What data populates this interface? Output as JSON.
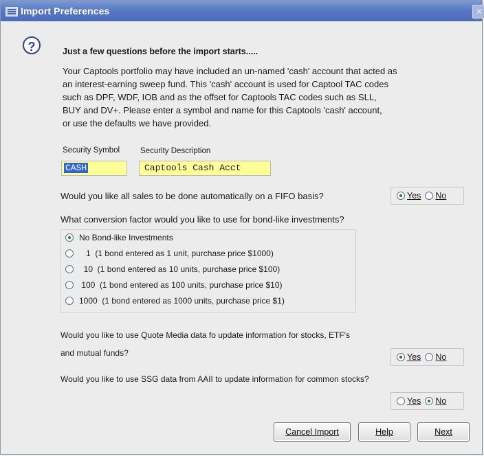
{
  "window": {
    "title": "Import Preferences"
  },
  "header": {
    "heading": "Just a few questions before the import starts....."
  },
  "intro": {
    "lines": [
      "Your Captools portfolio may have included an un-named 'cash' account that acted as",
      "an interest-earning sweep fund. This 'cash' account is used for Captool TAC codes",
      "such as DPF, WDF, IOB and as the offset for Captools TAC codes such as SLL,",
      "BUY and DV+. Please enter a symbol and name for this Captools 'cash' account,",
      "or use the defaults we have provided."
    ]
  },
  "cash": {
    "symbol_label": "Security Symbol",
    "description_label": "Security Description",
    "symbol_value": "CASH",
    "description_value": "Captools Cash Acct"
  },
  "fifo": {
    "question": "Would you like all sales to be done automatically on a FIFO basis?",
    "yes_label": "Yes",
    "no_label": "No",
    "selected": "Yes"
  },
  "bond": {
    "question": "What conversion factor would you like to use for bond-like investments?",
    "options": [
      {
        "label": "No Bond-like Investments",
        "selected": true
      },
      {
        "label": "   1  (1 bond entered as 1 unit, purchase price $1000)",
        "selected": false
      },
      {
        "label": "  10  (1 bond entered as 10 units, purchase price $100)",
        "selected": false
      },
      {
        "label": " 100  (1 bond entered as 100 units, purchase price $10)",
        "selected": false
      },
      {
        "label": "1000  (1 bond entered as 1000 units, purchase price $1)",
        "selected": false
      }
    ]
  },
  "quote_media": {
    "question_line1": "Would you like to use Quote Media data fo update information for stocks,  ETF's",
    "question_line2": "and mutual funds?",
    "yes_label": "Yes",
    "no_label": "No",
    "selected": "Yes"
  },
  "ssg": {
    "question": "Would you like to use SSG data from AAII to update information for common stocks?",
    "yes_label": "Yes",
    "no_label": "No",
    "selected": "No"
  },
  "buttons": {
    "cancel": "Cancel Import",
    "help": "Help",
    "next": "Next"
  },
  "colors": {
    "titlebar": "#5576c2",
    "field_bg": "#ffff99",
    "selection": "#3366cc"
  }
}
